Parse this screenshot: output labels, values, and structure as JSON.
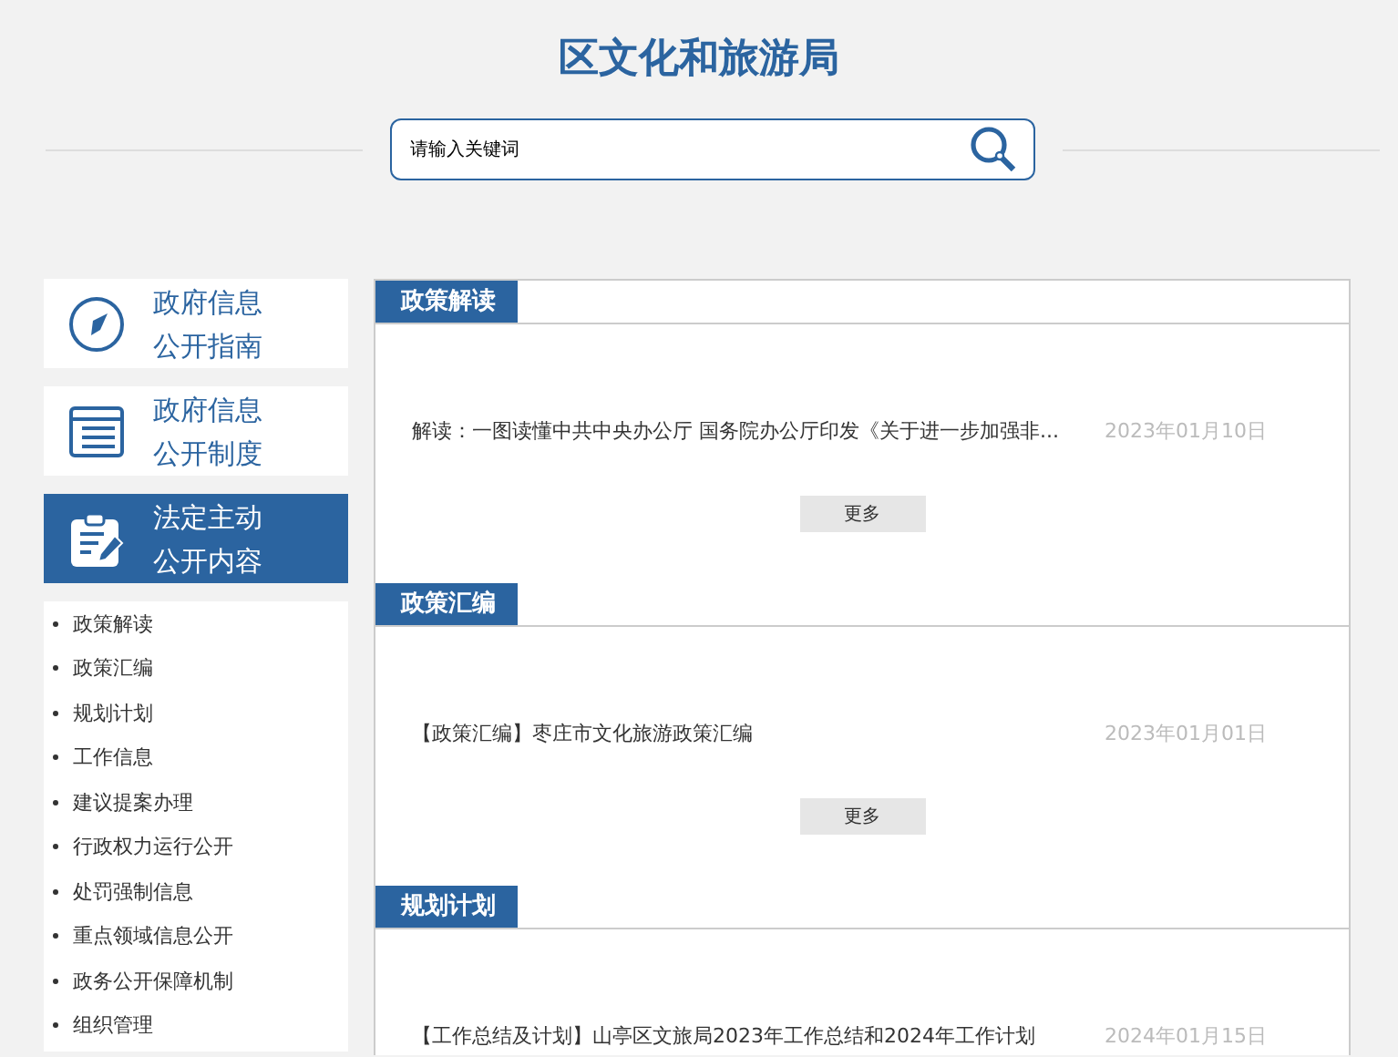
{
  "site_title": "区文化和旅游局",
  "search": {
    "placeholder": "请输入关键词"
  },
  "sidebar": {
    "cards": [
      {
        "kind": "compass",
        "lines": [
          "政府信息",
          "公开指南"
        ],
        "selected": false
      },
      {
        "kind": "list",
        "lines": [
          "政府信息",
          "公开制度"
        ],
        "selected": false
      },
      {
        "kind": "clipboard",
        "lines": [
          "法定主动",
          "公开内容"
        ],
        "selected": true
      }
    ],
    "items": [
      "政策解读",
      "政策汇编",
      "规划计划",
      "工作信息",
      "建议提案办理",
      "行政权力运行公开",
      "处罚强制信息",
      "重点领域信息公开",
      "政务公开保障机制",
      "组织管理"
    ]
  },
  "sections": [
    {
      "title": "政策解读",
      "items": [
        {
          "text": "解读：一图读懂中共中央办公厅 国务院办公厅印发《关于进一步加强非...",
          "date": "2023年01月10日"
        }
      ],
      "more": "更多"
    },
    {
      "title": "政策汇编",
      "items": [
        {
          "text": "【政策汇编】枣庄市文化旅游政策汇编",
          "date": "2023年01月01日"
        }
      ],
      "more": "更多"
    },
    {
      "title": "规划计划",
      "items": [
        {
          "text": "【工作总结及计划】山亭区文旅局2023年工作总结和2024年工作计划",
          "date": "2024年01月15日"
        }
      ]
    }
  ]
}
